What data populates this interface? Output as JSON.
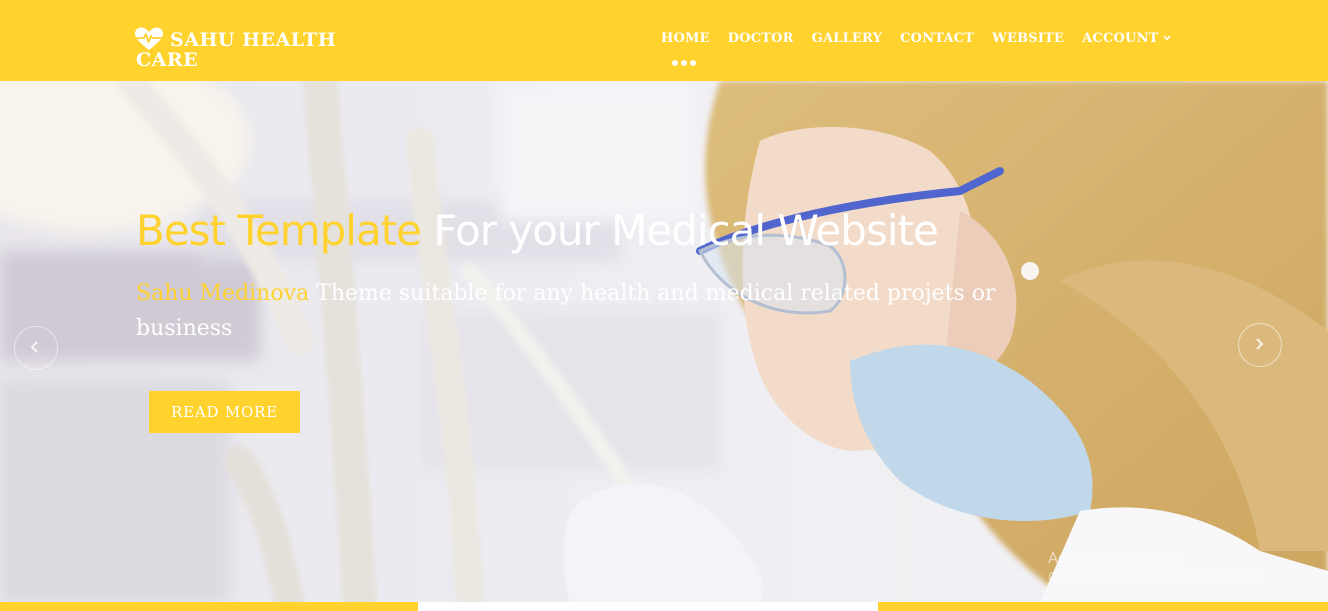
{
  "brand": {
    "line1": "SAHU HEALTH",
    "line2": "CARE",
    "icon": "heart-pulse-icon"
  },
  "nav": {
    "items": [
      {
        "label": "HOME",
        "active": true
      },
      {
        "label": "DOCTOR"
      },
      {
        "label": "GALLERY"
      },
      {
        "label": "CONTACT"
      },
      {
        "label": "WEBSITE"
      },
      {
        "label": "ACCOUNT",
        "dropdown": true
      }
    ],
    "caret_icon": "chevron-down-icon"
  },
  "hero": {
    "title_accent": "Best Template",
    "title_rest": "For your Medical Website",
    "subtitle_accent": "Sahu Medinova",
    "subtitle_rest": "Theme suitable for any health and medical related projets or business",
    "button_label": "READ MORE",
    "prev_icon": "chevron-left-icon",
    "next_icon": "chevron-right-icon"
  },
  "watermark": {
    "line1": "Activate Windows",
    "line2": "Go to Settings to activate Windows."
  },
  "colors": {
    "accent": "#ffd22e",
    "text_light": "#ffffff"
  }
}
